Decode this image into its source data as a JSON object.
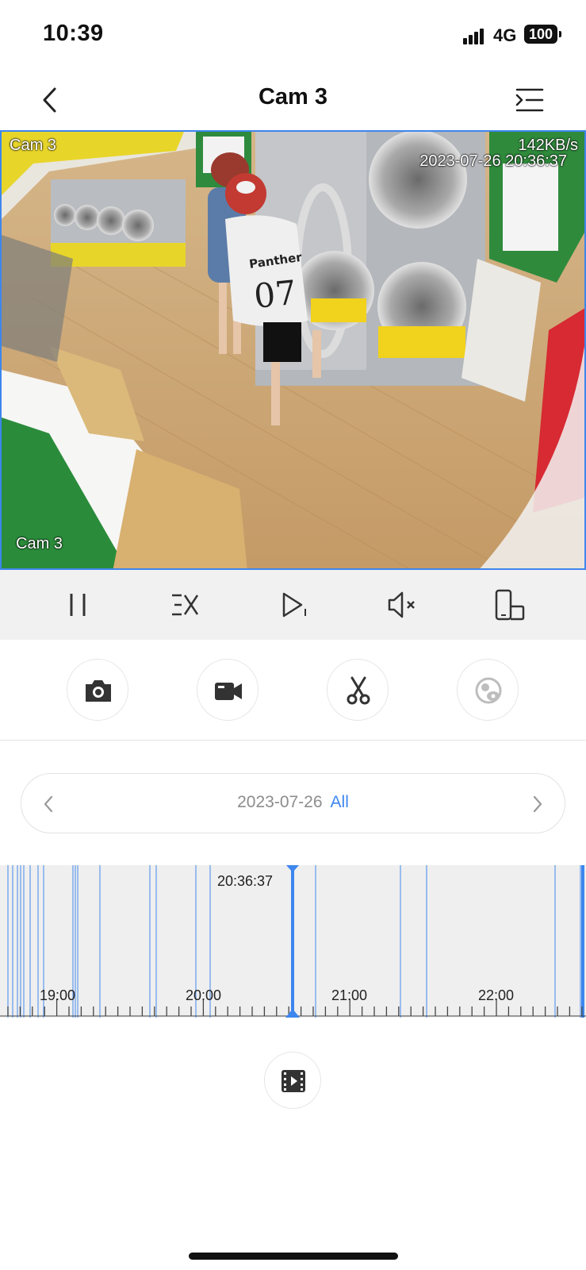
{
  "status_bar": {
    "time": "10:39",
    "network": "4G",
    "battery": "100"
  },
  "nav": {
    "title": "Cam 3"
  },
  "video": {
    "camera_label_top": "Cam 3",
    "bitrate": "142KB/s",
    "timestamp": "2023-07-26 20:36:37",
    "camera_label_bottom": "Cam 3",
    "shirt_text": "Panther",
    "shirt_number": "07"
  },
  "controls": {
    "items": [
      "pause-icon",
      "speed-icon",
      "next-frame-icon",
      "mute-icon",
      "orientation-icon"
    ]
  },
  "actions": {
    "items": [
      "camera-icon",
      "video-camera-icon",
      "scissors-icon",
      "face-search-icon"
    ]
  },
  "date_picker": {
    "date": "2023-07-26",
    "filter": "All"
  },
  "timeline": {
    "cursor_time": "20:36:37",
    "hour_labels": [
      "19:00",
      "20:00",
      "21:00",
      "22:00"
    ]
  },
  "colors": {
    "accent": "#3d86ee",
    "timeline_bg": "#efefef",
    "controls_bg": "#f1f1f1"
  }
}
